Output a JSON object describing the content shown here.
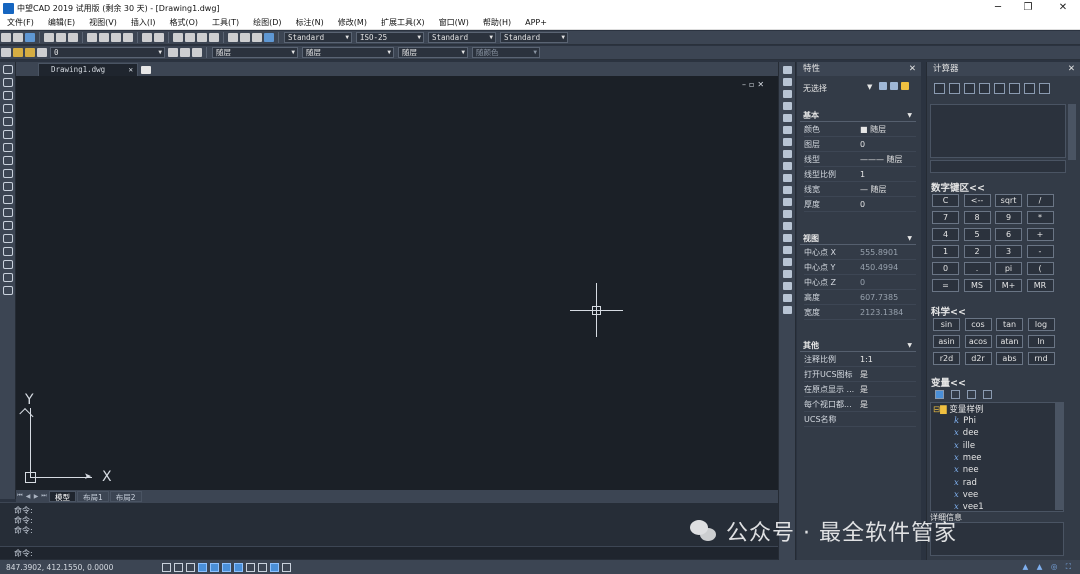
{
  "window": {
    "title": "中望CAD 2019 试用版 (剩余 30 天) - [Drawing1.dwg]"
  },
  "menu": [
    "文件(F)",
    "编辑(E)",
    "视图(V)",
    "插入(I)",
    "格式(O)",
    "工具(T)",
    "绘图(D)",
    "标注(N)",
    "修改(M)",
    "扩展工具(X)",
    "窗口(W)",
    "帮助(H)",
    "APP+"
  ],
  "toolbar1": {
    "textstyle": "Standard",
    "dimstyle": "ISO-25",
    "tablestyle": "Standard",
    "mleaderstyle": "Standard"
  },
  "toolbar2": {
    "layer": "0",
    "color": "随层",
    "linetype": "随层",
    "lineweight": "随层",
    "plotstyle": "随颜色"
  },
  "document": {
    "tab": "Drawing1.dwg",
    "layout_tabs": [
      "模型",
      "布局1",
      "布局2"
    ]
  },
  "ucs": {
    "x": "X",
    "y": "Y"
  },
  "command": {
    "lines": [
      "命令:",
      "命令:",
      "命令:"
    ],
    "prompt": "命令:"
  },
  "status": {
    "coords": "847.3902, 412.1550, 0.0000"
  },
  "properties": {
    "title": "特性",
    "selection": "无选择",
    "sections": [
      {
        "name": "基本",
        "rows": [
          [
            "颜色",
            "■ 随层"
          ],
          [
            "图层",
            "0"
          ],
          [
            "线型",
            "——— 随层"
          ],
          [
            "线型比例",
            "1"
          ],
          [
            "线宽",
            "— 随层"
          ],
          [
            "厚度",
            "0"
          ]
        ]
      },
      {
        "name": "视图",
        "rows": [
          [
            "中心点 X",
            "555.8901"
          ],
          [
            "中心点 Y",
            "450.4994"
          ],
          [
            "中心点 Z",
            "0"
          ],
          [
            "高度",
            "607.7385"
          ],
          [
            "宽度",
            "2123.1384"
          ]
        ]
      },
      {
        "name": "其他",
        "rows": [
          [
            "注释比例",
            "1:1"
          ],
          [
            "打开UCS图标",
            "是"
          ],
          [
            "在原点显示 ...",
            "是"
          ],
          [
            "每个视口都...",
            "是"
          ],
          [
            "UCS名称",
            ""
          ]
        ]
      }
    ]
  },
  "calculator": {
    "title": "计算器",
    "numpad_title": "数字键区<<",
    "numpad": [
      "C",
      "<--",
      "sqrt",
      "/",
      "7",
      "8",
      "9",
      "*",
      "4",
      "5",
      "6",
      "+",
      "1",
      "2",
      "3",
      "-",
      "0",
      ".",
      "pi",
      "(",
      "=",
      "MS",
      "M+",
      "MR"
    ],
    "sci_title": "科学<<",
    "sci": [
      "sin",
      "cos",
      "tan",
      "log",
      "asin",
      "acos",
      "atan",
      "ln",
      "r2d",
      "d2r",
      "abs",
      "rnd"
    ],
    "var_title": "变量<<",
    "var_group": "变量样例",
    "vars": [
      [
        "k",
        "Phi"
      ],
      [
        "x",
        "dee"
      ],
      [
        "x",
        "ille"
      ],
      [
        "x",
        "mee"
      ],
      [
        "x",
        "nee"
      ],
      [
        "x",
        "rad"
      ],
      [
        "x",
        "vee"
      ],
      [
        "x",
        "vee1"
      ]
    ],
    "detail": "详细信息"
  },
  "watermark": "公众号 · 最全软件管家"
}
